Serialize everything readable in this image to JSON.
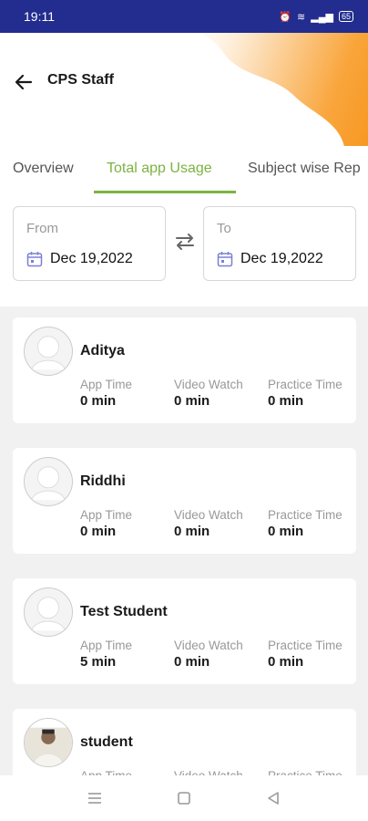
{
  "status_bar": {
    "time": "19:11",
    "battery": "65"
  },
  "header": {
    "title": "CPS Staff"
  },
  "tabs": [
    {
      "label": "Overview",
      "active": false
    },
    {
      "label": "Total app Usage",
      "active": true
    },
    {
      "label": "Subject wise Rep",
      "active": false
    }
  ],
  "date_range": {
    "from_label": "From",
    "from_value": "Dec 19,2022",
    "to_label": "To",
    "to_value": "Dec 19,2022"
  },
  "stat_labels": {
    "app_time": "App Time",
    "video_watch": "Video Watch",
    "practice_time": "Practice Time"
  },
  "students": [
    {
      "name": "Aditya",
      "app_time": "0 min",
      "video_watch": "0 min",
      "practice_time": "0 min",
      "avatar": "default"
    },
    {
      "name": "Riddhi",
      "app_time": "0 min",
      "video_watch": "0 min",
      "practice_time": "0 min",
      "avatar": "default"
    },
    {
      "name": "Test Student",
      "app_time": "5 min",
      "video_watch": "0 min",
      "practice_time": "0 min",
      "avatar": "default"
    },
    {
      "name": "student",
      "app_time": "",
      "video_watch": "",
      "practice_time": "",
      "avatar": "photo"
    }
  ],
  "colors": {
    "accent": "#7cb342",
    "status_bar": "#232d8f",
    "header_blob": "#f7941d"
  }
}
